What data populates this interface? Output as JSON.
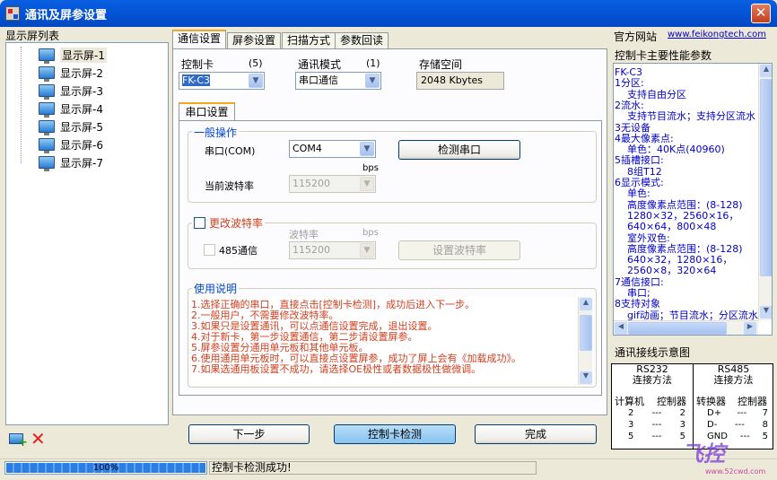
{
  "window": {
    "title": "通讯及屏参设置",
    "close": "✕"
  },
  "left": {
    "title": "显示屏列表",
    "screens": [
      "显示屏-1",
      "显示屏-2",
      "显示屏-3",
      "显示屏-4",
      "显示屏-5",
      "显示屏-6",
      "显示屏-7"
    ]
  },
  "tabs": [
    "通信设置",
    "屏参设置",
    "扫描方式",
    "参数回读"
  ],
  "card": {
    "label": "控制卡",
    "count": "(5)",
    "value": "FK-C3"
  },
  "mode": {
    "label": "通讯模式",
    "count": "(1)",
    "value": "串口通信"
  },
  "storage": {
    "label": "存储空间",
    "value": "2048 Kbytes"
  },
  "subtab": "串口设置",
  "general": {
    "legend": "一般操作",
    "port_label": "串口(COM)",
    "port_value": "COM4",
    "detect": "检测串口",
    "bps": "bps",
    "current_label": "当前波特率",
    "current_value": "115200"
  },
  "change": {
    "legend": "更改波特率",
    "baud_label": "波特率",
    "bps": "bps",
    "rs485": "485通信",
    "baud_value": "115200",
    "set_btn": "设置波特率"
  },
  "help": {
    "legend": "使用说明",
    "lines": [
      "1.选择正确的串口，直接点击[控制卡检测]，成功后进入下一步。",
      "2.一般用户，不需要修改波特率。",
      "3.如果只是设置通讯，可以点通信设置完成，退出设置。",
      "4.对于新卡，第一步设置通信，第二步请设置屏参。",
      "5.屏参设置分通用单元板和其他单元板。",
      "6.使用通用单元板时，可以直接点设置屏参，成功了屏上会有《加载成功》。",
      "7.如果选通用板设置不成功，请选择OE极性或者数据极性做微调。"
    ]
  },
  "buttons": {
    "next": "下一步",
    "detect": "控制卡检测",
    "finish": "完成"
  },
  "right": {
    "site_label": "官方网站",
    "site_url": "www.feikongtech.com",
    "perf_title": "控制卡主要性能参数",
    "perf": [
      "FK-C3",
      "1分区:",
      "    支持自由分区",
      "2流水:",
      "    支持节目流水；支持分区流水",
      "3无设备",
      "4最大像素点:",
      "    单色：40K点(40960)",
      "5插槽接口:",
      "    8组T12",
      "6显示模式:",
      "    单色:",
      "    高度像素点范围：(8-128)",
      "    1280×32，2560×16，",
      "    640×64，800×48",
      "    室外双色:",
      "    高度像素点范围：(8-128)",
      "    640×32，1280×16，",
      "    2560×8，320×64",
      "7通信接口:",
      "    串口;",
      "8支持对象",
      "    gif动画；节目流水；分区流水"
    ],
    "wiring_title": "通讯接线示意图",
    "rs232_t": "RS232",
    "rs232_s": "连接方法",
    "rs485_t": "RS485",
    "rs485_s": "连接方法",
    "pc": "计算机",
    "ctl": "控制器",
    "conv": "转换器",
    "ctl2": "控制器",
    "rows232": [
      [
        "2",
        "2"
      ],
      [
        "3",
        "3"
      ],
      [
        "5",
        "5"
      ]
    ],
    "rows485": [
      [
        "D+",
        "7"
      ],
      [
        "D-",
        "8"
      ],
      [
        "GND",
        "5"
      ]
    ]
  },
  "status": {
    "progress_label": "100%",
    "progress": 1.0,
    "message": "控制卡检测成功!"
  },
  "watermark": {
    "logo": "飞控",
    "url": "www.52cwd.com"
  }
}
